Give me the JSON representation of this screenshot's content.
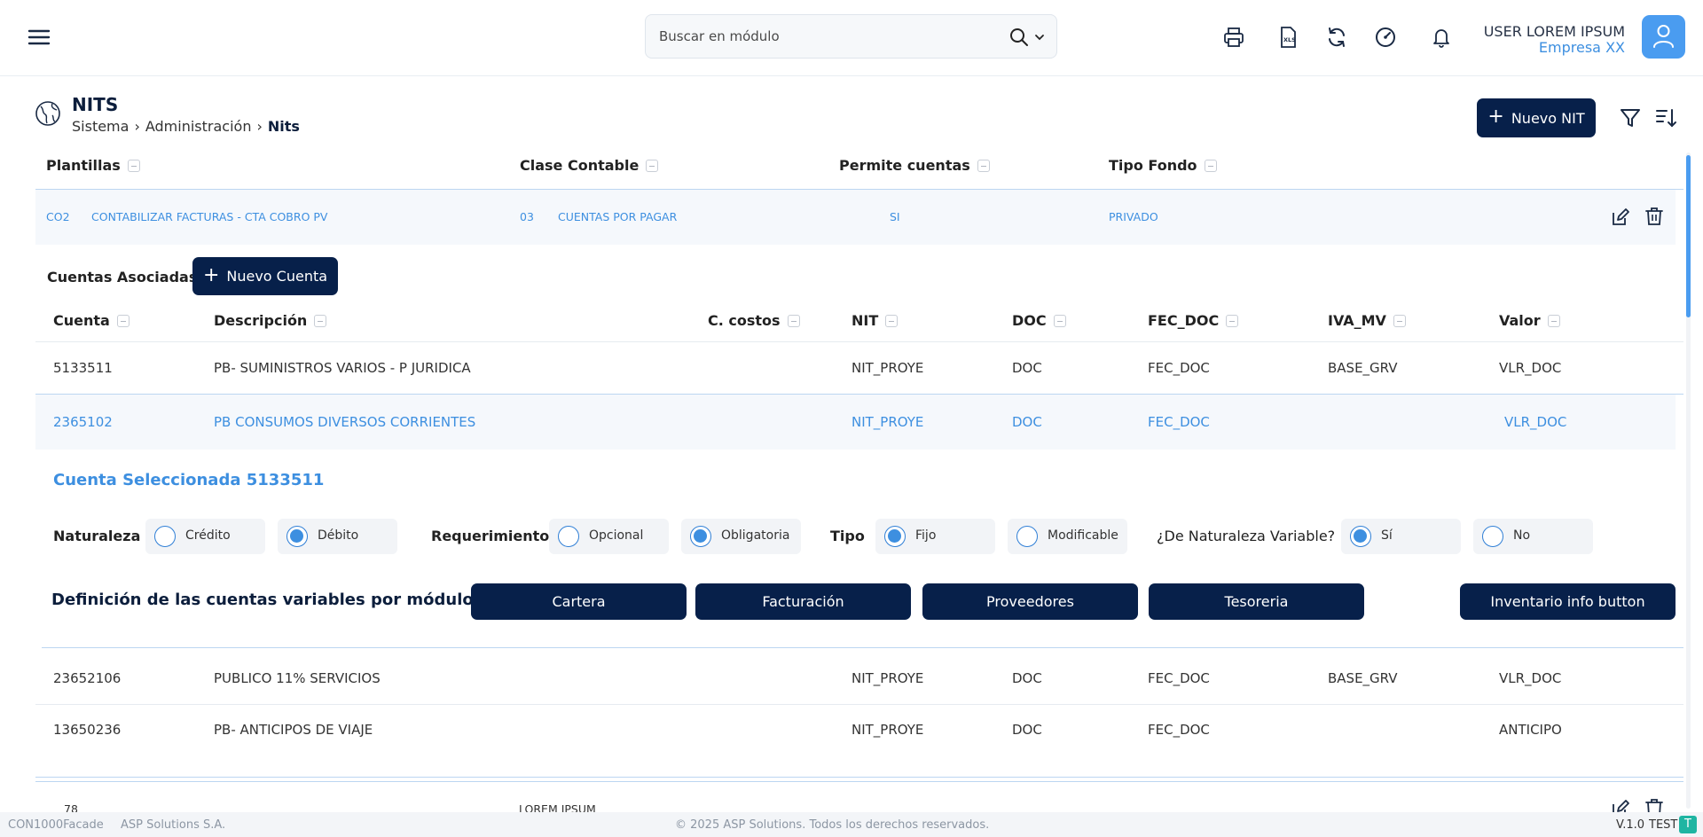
{
  "search": {
    "placeholder": "Buscar en módulo"
  },
  "user": {
    "name": "USER LOREM IPSUM",
    "company": "Empresa XX"
  },
  "page": {
    "title": "NITS",
    "breadcrumb": [
      "Sistema",
      "Administración",
      "Nits"
    ]
  },
  "actions": {
    "new_nit": "Nuevo NIT",
    "new_cuenta": "Nuevo Cuenta"
  },
  "template_table": {
    "headers": [
      "Plantillas",
      "Clase Contable",
      "Permite cuentas",
      "Tipo Fondo"
    ],
    "row": {
      "code": "CO2",
      "name": "CONTABILIZAR FACTURAS - CTA COBRO PV",
      "class_code": "03",
      "class_name": "CUENTAS POR PAGAR",
      "permite": "SI",
      "fondo": "PRIVADO"
    }
  },
  "accounts": {
    "label": "Cuentas Asociadas",
    "headers": [
      "Cuenta",
      "Descripción",
      "C. costos",
      "NIT",
      "DOC",
      "FEC_DOC",
      "IVA_MV",
      "Valor"
    ],
    "rows": [
      {
        "cuenta": "5133511",
        "descripcion": "PB- SUMINISTROS VARIOS - P JURIDICA",
        "nit": "NIT_PROYE",
        "doc": "DOC",
        "fec": "FEC_DOC",
        "iva": "BASE_GRV",
        "valor": "VLR_DOC"
      },
      {
        "cuenta": "2365102",
        "descripcion": "PB  CONSUMOS DIVERSOS CORRIENTES",
        "nit": "NIT_PROYE",
        "doc": "DOC",
        "fec": "FEC_DOC",
        "iva": "",
        "valor": "VLR_DOC"
      },
      {
        "cuenta": "23652106",
        "descripcion": "PUBLICO 11% SERVICIOS",
        "nit": "NIT_PROYE",
        "doc": "DOC",
        "fec": "FEC_DOC",
        "iva": "BASE_GRV",
        "valor": "VLR_DOC"
      },
      {
        "cuenta": "13650236",
        "descripcion": "PB- ANTICIPOS DE VIAJE",
        "nit": "NIT_PROYE",
        "doc": "DOC",
        "fec": "FEC_DOC",
        "iva": "",
        "valor": "ANTICIPO"
      }
    ]
  },
  "selected": {
    "title": "Cuenta Seleccionada 5133511",
    "naturaleza": {
      "label": "Naturaleza",
      "options": [
        "Crédito",
        "Débito"
      ],
      "selected": "Débito"
    },
    "requerimiento": {
      "label": "Requerimiento",
      "options": [
        "Opcional",
        "Obligatoria"
      ],
      "selected": "Obligatoria"
    },
    "tipo": {
      "label": "Tipo",
      "options": [
        "Fijo",
        "Modificable"
      ],
      "selected": "Fijo"
    },
    "variable": {
      "label": "¿De Naturaleza Variable?",
      "options": [
        "Sí",
        "No"
      ],
      "selected": "Sí"
    }
  },
  "modules": {
    "title": "Definición de las cuentas variables por módulos",
    "buttons": [
      "Cartera",
      "Facturación",
      "Proveedores",
      "Tesoreria",
      "Inventario info button"
    ]
  },
  "next_row": {
    "code": "78",
    "name": "LOREM IPSUM"
  },
  "footer": {
    "facade": "CON1000Facade",
    "company": "ASP Solutions S.A.",
    "copyright": "© 2025 ASP Solutions. Todos los derechos reservados.",
    "version": "V.1.0",
    "env": "TEST",
    "env_badge": "T"
  },
  "colors": {
    "primary": "#07204a",
    "accent": "#3d8fe0",
    "teal": "#1fb5a2"
  },
  "icons": [
    "menu-icon",
    "search-icon",
    "chevron-down-icon",
    "printer-icon",
    "xls-file-icon",
    "refresh-icon",
    "speedometer-icon",
    "bell-icon",
    "user-icon",
    "globe-icon",
    "filter-icon",
    "sort-icon",
    "edit-icon",
    "trash-icon"
  ]
}
